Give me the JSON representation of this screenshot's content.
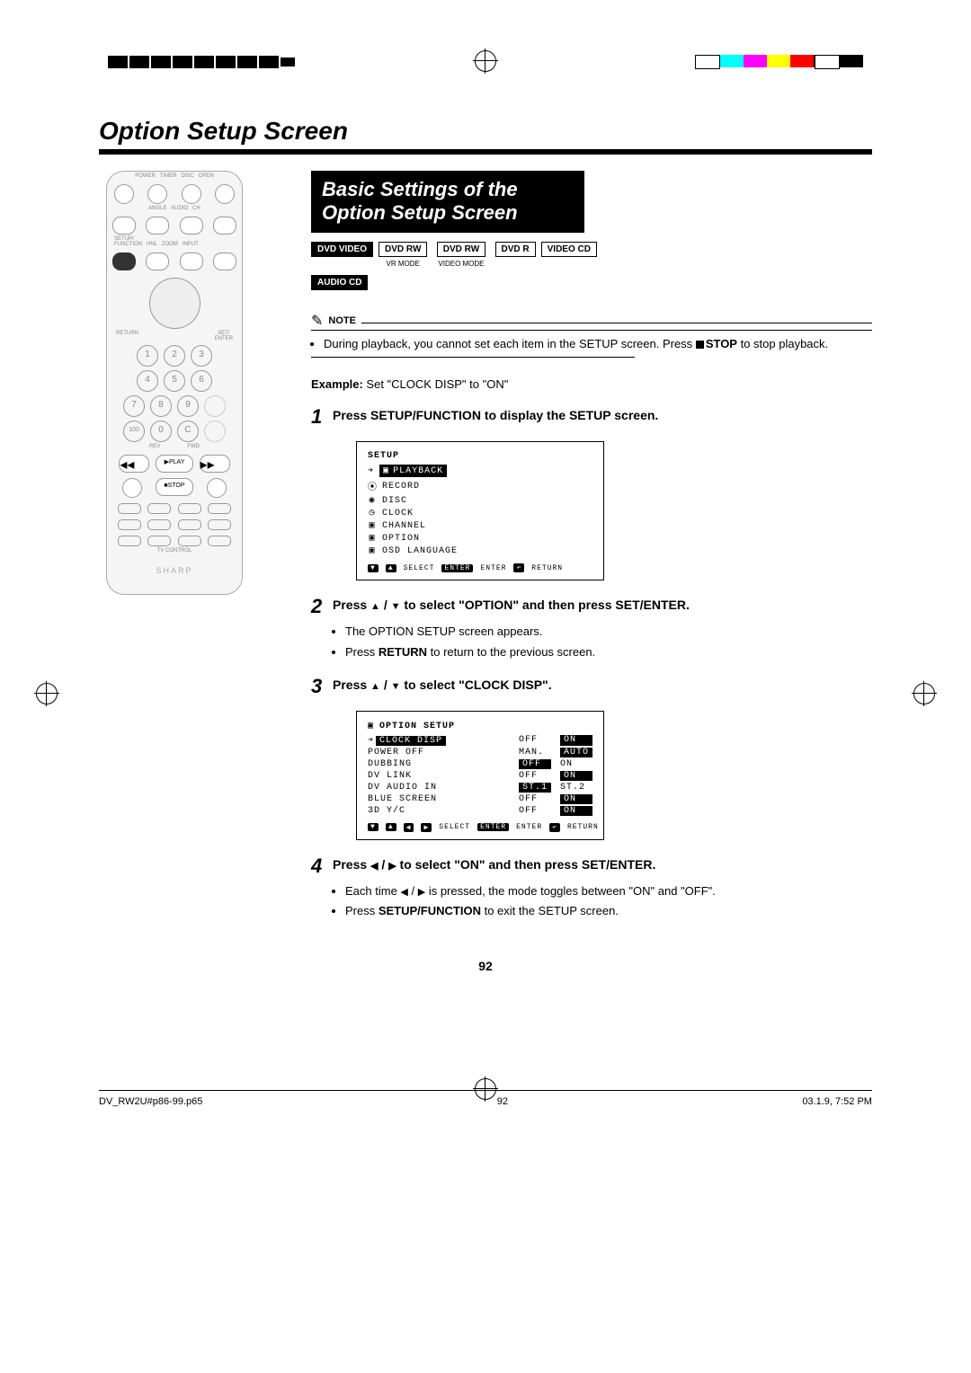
{
  "page": {
    "title": "Option Setup Screen",
    "number": "92"
  },
  "heading": "Basic Settings of the Option Setup Screen",
  "format_tags": {
    "solid": [
      "DVD VIDEO",
      "AUDIO CD"
    ],
    "outline": [
      {
        "label": "DVD RW",
        "sub": "VR MODE"
      },
      {
        "label": "DVD RW",
        "sub": "VIDEO MODE"
      },
      {
        "label": "DVD R",
        "sub": ""
      },
      {
        "label": "VIDEO CD",
        "sub": ""
      }
    ]
  },
  "note": {
    "title": "NOTE",
    "items": [
      "During playback, you cannot set each item in the SETUP screen. Press ■STOP to stop playback."
    ],
    "stop_word": "STOP"
  },
  "example": {
    "label": "Example:",
    "text": " Set \"CLOCK DISP\" to \"ON\""
  },
  "steps": [
    {
      "n": "1",
      "bold_pre": "Press ",
      "bold": "SETUP/FUNCTION",
      "bold_post": " to display the SETUP screen."
    },
    {
      "n": "2",
      "bold_pre": "Press ",
      "arrows": "▲ / ▼",
      "bold_mid": " to select \"OPTION\" and then press ",
      "bold": "SET/ENTER",
      "bold_post": ".",
      "bullets": [
        "The OPTION SETUP screen appears.",
        "Press RETURN to return to the previous screen."
      ],
      "bullets_bold": [
        "RETURN"
      ]
    },
    {
      "n": "3",
      "bold_pre": "Press ",
      "arrows": "▲ / ▼",
      "bold_mid": " to select \"CLOCK DISP\".",
      "bold": "",
      "bold_post": ""
    },
    {
      "n": "4",
      "bold_pre": "Press ",
      "arrows": "◀ / ▶",
      "bold_mid": " to select \"ON\" and then press ",
      "bold": "SET/ENTER",
      "bold_post": ".",
      "bullets": [
        "Each time ◀ / ▶ is pressed, the mode toggles between \"ON\" and \"OFF\".",
        "Press SETUP/FUNCTION to exit the SETUP screen."
      ],
      "bullets_bold": [
        "SETUP/FUNCTION"
      ]
    }
  ],
  "osd1": {
    "title": "SETUP",
    "selected": "PLAYBACK",
    "items": [
      "RECORD",
      "DISC",
      "CLOCK",
      "CHANNEL",
      "OPTION",
      "OSD LANGUAGE"
    ],
    "footer": {
      "select": "SELECT",
      "enter_pill": "ENTER",
      "enter": "ENTER",
      "return": "RETURN"
    }
  },
  "osd2": {
    "title": "OPTION SETUP",
    "rows": [
      {
        "label": "CLOCK DISP",
        "off": "OFF",
        "on": "ON",
        "sel_label": true,
        "on_hi": true
      },
      {
        "label": "POWER OFF",
        "off": "MAN.",
        "on": "AUTO",
        "on_hi": true
      },
      {
        "label": "DUBBING",
        "off": "OFF",
        "on": "ON",
        "off_hi": true
      },
      {
        "label": "DV LINK",
        "off": "OFF",
        "on": "ON",
        "on_hi": true
      },
      {
        "label": "DV AUDIO IN",
        "off": "ST.1",
        "on": "ST.2",
        "off_hi": true
      },
      {
        "label": "BLUE SCREEN",
        "off": "OFF",
        "on": "ON",
        "on_hi": true
      },
      {
        "label": "3D Y/C",
        "off": "OFF",
        "on": "ON",
        "on_hi": true
      }
    ],
    "footer": {
      "select": "SELECT",
      "enter_pill": "ENTER",
      "enter": "ENTER",
      "return": "RETURN"
    }
  },
  "footer": {
    "file": "DV_RW2U#p86-99.p65",
    "page": "92",
    "date": "03.1.9, 7:52 PM"
  },
  "remote_brand": "SHARP"
}
